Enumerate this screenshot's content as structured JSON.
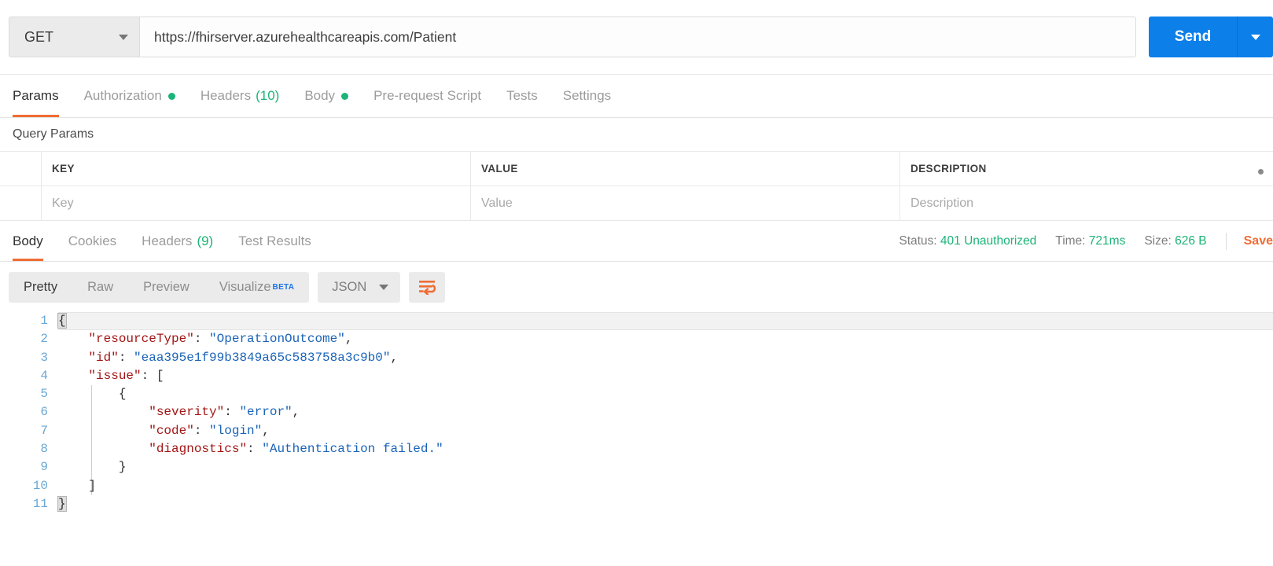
{
  "request": {
    "method": "GET",
    "url": "https://fhirserver.azurehealthcareapis.com/Patient",
    "send_label": "Send",
    "tabs": [
      {
        "label": "Params",
        "active": true,
        "dot": false,
        "count": null
      },
      {
        "label": "Authorization",
        "active": false,
        "dot": true,
        "count": null
      },
      {
        "label": "Headers",
        "active": false,
        "dot": false,
        "count": "(10)"
      },
      {
        "label": "Body",
        "active": false,
        "dot": true,
        "count": null
      },
      {
        "label": "Pre-request Script",
        "active": false,
        "dot": false,
        "count": null
      },
      {
        "label": "Tests",
        "active": false,
        "dot": false,
        "count": null
      },
      {
        "label": "Settings",
        "active": false,
        "dot": false,
        "count": null
      }
    ]
  },
  "query_params": {
    "title": "Query Params",
    "headers": {
      "key": "KEY",
      "value": "VALUE",
      "description": "DESCRIPTION"
    },
    "placeholders": {
      "key": "Key",
      "value": "Value",
      "description": "Description"
    }
  },
  "response": {
    "tabs": [
      {
        "label": "Body",
        "active": true,
        "count": null
      },
      {
        "label": "Cookies",
        "active": false,
        "count": null
      },
      {
        "label": "Headers",
        "active": false,
        "count": "(9)"
      },
      {
        "label": "Test Results",
        "active": false,
        "count": null
      }
    ],
    "status_label": "Status:",
    "status_value": "401 Unauthorized",
    "time_label": "Time:",
    "time_value": "721ms",
    "size_label": "Size:",
    "size_value": "626 B",
    "save_label": "Save"
  },
  "viewer": {
    "modes": [
      {
        "label": "Pretty",
        "active": true,
        "beta": null
      },
      {
        "label": "Raw",
        "active": false,
        "beta": null
      },
      {
        "label": "Preview",
        "active": false,
        "beta": null
      },
      {
        "label": "Visualize",
        "active": false,
        "beta": "BETA"
      }
    ],
    "format": "JSON",
    "wrap_icon": "wrap-text-icon"
  },
  "body": {
    "line_numbers": [
      "1",
      "2",
      "3",
      "4",
      "5",
      "6",
      "7",
      "8",
      "9",
      "10",
      "11"
    ],
    "lines": [
      {
        "n": 1,
        "indent": 0,
        "text": "{"
      },
      {
        "n": 2,
        "indent": 1,
        "key": "\"resourceType\"",
        "value": "\"OperationOutcome\"",
        "comma": ","
      },
      {
        "n": 3,
        "indent": 1,
        "key": "\"id\"",
        "value": "\"eaa395e1f99b3849a65c583758a3c9b0\"",
        "comma": ","
      },
      {
        "n": 4,
        "indent": 1,
        "key": "\"issue\"",
        "value": "[",
        "comma": ""
      },
      {
        "n": 5,
        "indent": 2,
        "text": "{"
      },
      {
        "n": 6,
        "indent": 3,
        "key": "\"severity\"",
        "value": "\"error\"",
        "comma": ","
      },
      {
        "n": 7,
        "indent": 3,
        "key": "\"code\"",
        "value": "\"login\"",
        "comma": ","
      },
      {
        "n": 8,
        "indent": 3,
        "key": "\"diagnostics\"",
        "value": "\"Authentication failed.\"",
        "comma": ""
      },
      {
        "n": 9,
        "indent": 2,
        "text": "}"
      },
      {
        "n": 10,
        "indent": 1,
        "text": "]"
      },
      {
        "n": 11,
        "indent": 0,
        "text": "}"
      }
    ],
    "raw": {
      "resourceType": "OperationOutcome",
      "id": "eaa395e1f99b3849a65c583758a3c9b0",
      "issue": [
        {
          "severity": "error",
          "code": "login",
          "diagnostics": "Authentication failed."
        }
      ]
    }
  },
  "colors": {
    "accent_orange": "#f06c34",
    "send_blue": "#0c7fe8",
    "status_green": "#1cb477",
    "beta_blue": "#1a73e8",
    "json_key": "#a31515",
    "json_string": "#1a63b8",
    "gutter_number": "#6aa7d4"
  }
}
